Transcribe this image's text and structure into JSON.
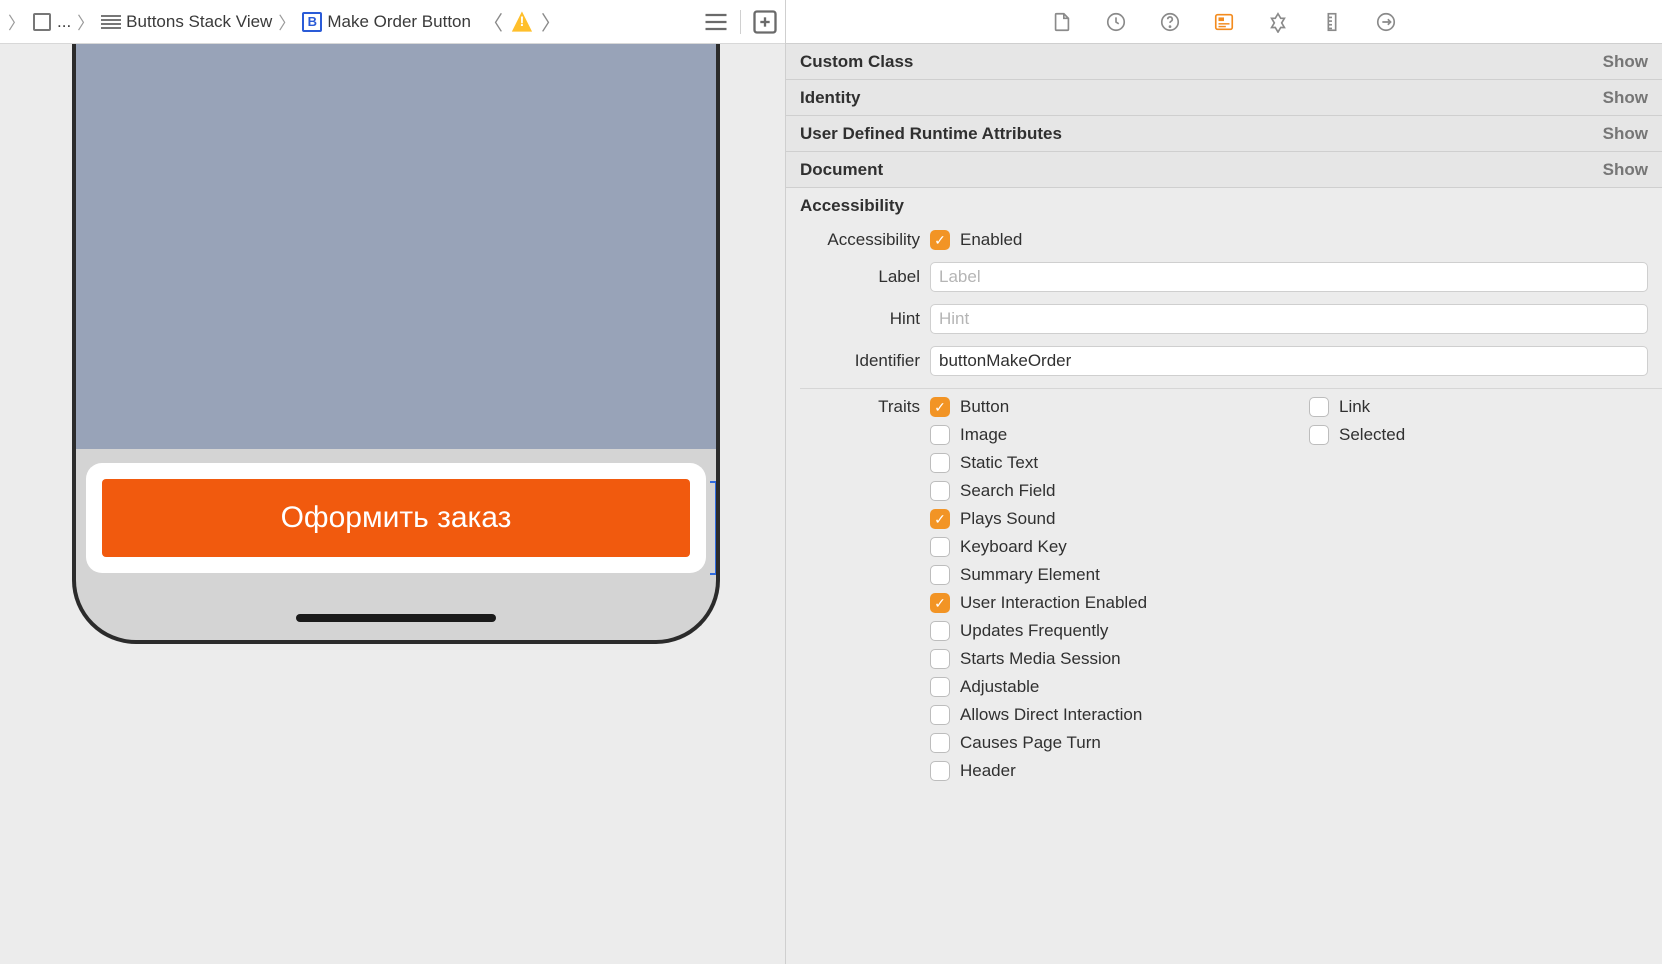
{
  "breadcrumb": {
    "ellipsis": "...",
    "stack_view": "Buttons Stack View",
    "selected": "Make Order Button",
    "b_glyph": "B"
  },
  "canvas": {
    "button_label": "Оформить заказ"
  },
  "sections": {
    "custom_class": {
      "title": "Custom Class",
      "action": "Show"
    },
    "identity": {
      "title": "Identity",
      "action": "Show"
    },
    "udra": {
      "title": "User Defined Runtime Attributes",
      "action": "Show"
    },
    "document": {
      "title": "Document",
      "action": "Show"
    },
    "accessibility": {
      "title": "Accessibility"
    }
  },
  "a11y": {
    "row_accessibility": "Accessibility",
    "enabled_label": "Enabled",
    "label_label": "Label",
    "label_placeholder": "Label",
    "hint_label": "Hint",
    "hint_placeholder": "Hint",
    "identifier_label": "Identifier",
    "identifier_value": "buttonMakeOrder",
    "traits_label": "Traits"
  },
  "traits": {
    "button": "Button",
    "link": "Link",
    "image": "Image",
    "selected": "Selected",
    "static_text": "Static Text",
    "search_field": "Search Field",
    "plays_sound": "Plays Sound",
    "keyboard_key": "Keyboard Key",
    "summary": "Summary Element",
    "ui_enabled": "User Interaction Enabled",
    "updates": "Updates Frequently",
    "media": "Starts Media Session",
    "adjustable": "Adjustable",
    "direct": "Allows Direct Interaction",
    "page_turn": "Causes Page Turn",
    "header": "Header"
  }
}
